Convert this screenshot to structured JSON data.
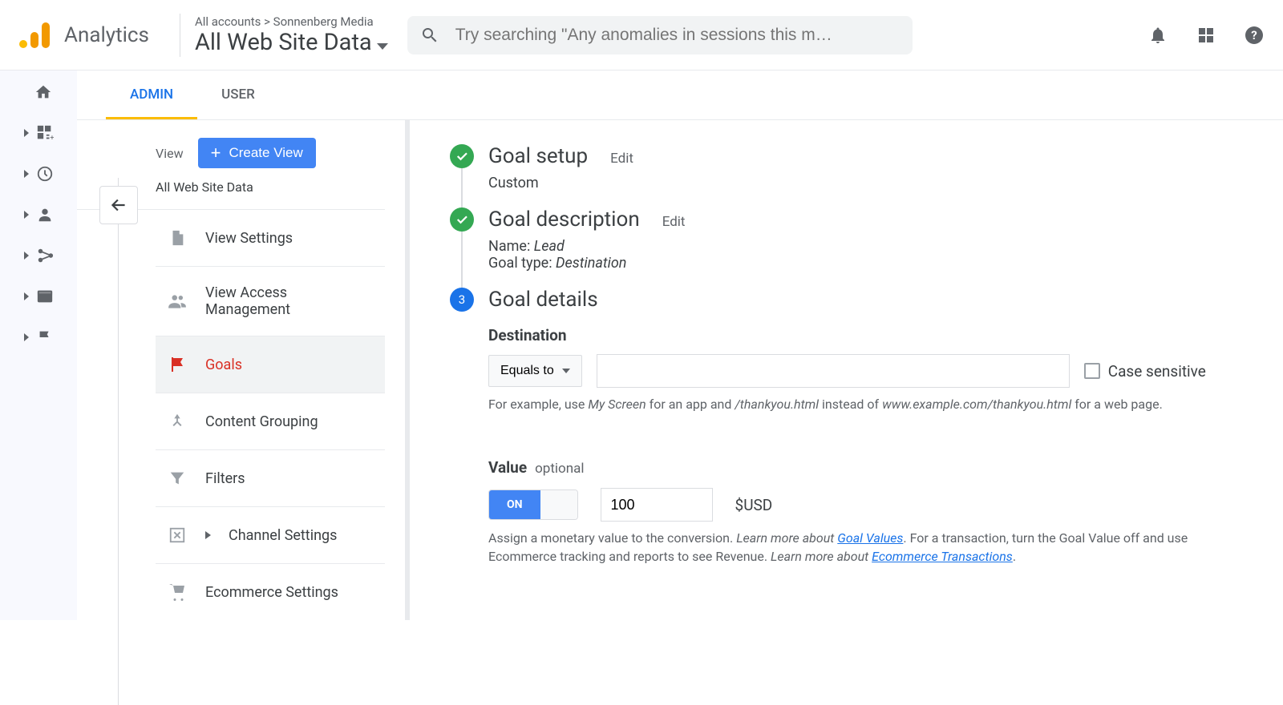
{
  "header": {
    "product": "Analytics",
    "breadcrumb": "All accounts > Sonnenberg Media",
    "view": "All Web Site Data",
    "search_placeholder": "Try searching \"Any anomalies in sessions this m…"
  },
  "tabs": {
    "admin": "ADMIN",
    "user": "USER"
  },
  "admin_col": {
    "label": "View",
    "create_btn": "Create View",
    "viewname": "All Web Site Data",
    "items": [
      {
        "label": "View Settings",
        "icon": "file-icon"
      },
      {
        "label": "View Access Management",
        "icon": "people-icon"
      },
      {
        "label": "Goals",
        "icon": "flag-icon",
        "active": true
      },
      {
        "label": "Content Grouping",
        "icon": "merge-icon"
      },
      {
        "label": "Filters",
        "icon": "funnel-icon"
      },
      {
        "label": "Channel Settings",
        "icon": "channel-icon",
        "expandable": true
      },
      {
        "label": "Ecommerce Settings",
        "icon": "cart-icon"
      }
    ]
  },
  "goal": {
    "step1": {
      "title": "Goal setup",
      "edit": "Edit",
      "value": "Custom"
    },
    "step2": {
      "title": "Goal description",
      "edit": "Edit",
      "name_label": "Name:",
      "name_value": "Lead",
      "type_label": "Goal type:",
      "type_value": "Destination"
    },
    "step3": {
      "num": "3",
      "title": "Goal details",
      "destination": {
        "label": "Destination",
        "match": "Equals to",
        "input_value": "",
        "case_sensitive": "Case sensitive",
        "hint_pre": "For example, use ",
        "hint_em1": "My Screen",
        "hint_mid": " for an app and ",
        "hint_em2": "/thankyou.html",
        "hint_mid2": " instead of ",
        "hint_em3": "www.example.com/thankyou.html",
        "hint_post": " for a web page."
      },
      "value": {
        "label": "Value",
        "optional": "optional",
        "toggle": "ON",
        "amount": "100",
        "currency": "$USD",
        "hint_pre": "Assign a monetary value to the conversion. ",
        "hint_lm1": "Learn more about ",
        "hint_link1": "Goal Values",
        "hint_mid": ". For a transaction, turn the Goal Value off and use Ecommerce tracking and reports to see Revenue. ",
        "hint_lm2": "Learn more about ",
        "hint_link2": "Ecommerce Transactions",
        "hint_post": "."
      }
    }
  }
}
